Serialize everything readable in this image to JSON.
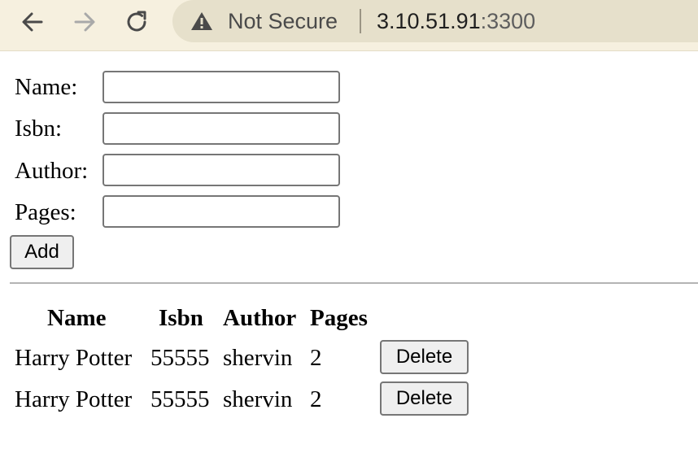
{
  "browser": {
    "security_label": "Not Secure",
    "url_host": "3.10.51.91",
    "url_port": ":3300",
    "icons": {
      "back": "back-arrow-icon",
      "forward": "forward-arrow-icon",
      "reload": "reload-icon",
      "security": "warning-triangle-icon"
    }
  },
  "form": {
    "name_label": "Name:",
    "name_value": "",
    "isbn_label": "Isbn:",
    "isbn_value": "",
    "author_label": "Author:",
    "author_value": "",
    "pages_label": "Pages:",
    "pages_value": "",
    "add_label": "Add"
  },
  "table": {
    "headers": [
      "Name",
      "Isbn",
      "Author",
      "Pages"
    ],
    "rows": [
      {
        "name": "Harry Potter",
        "isbn": "55555",
        "author": "shervin",
        "pages": "2",
        "action": "Delete"
      },
      {
        "name": "Harry Potter",
        "isbn": "55555",
        "author": "shervin",
        "pages": "2",
        "action": "Delete"
      }
    ]
  }
}
